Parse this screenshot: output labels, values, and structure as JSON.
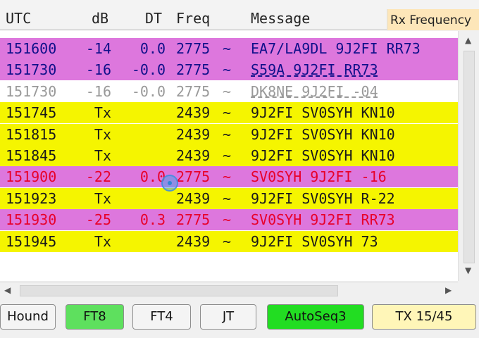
{
  "header": {
    "utc": "UTC",
    "db": "dB",
    "dt": "DT",
    "freq": "Freq",
    "message": "Message",
    "rx_frequency": "Rx Frequency"
  },
  "colors": {
    "header_bg": "#f3f3f3",
    "rx_tab_bg": "#fde6b9",
    "decode_for_me": "#dd77dd",
    "tx_row": "#f5f500",
    "normal_row": "#ffffff",
    "ft8_green": "#5ee05e",
    "autoseq_green": "#22dd22",
    "tx_period_bg": "#fff6b8"
  },
  "rows": [
    {
      "utc": "151600",
      "db": "-14",
      "dt": "0.0",
      "freq": "2775",
      "tilde": "~",
      "msg": "EA7/LA9DL 9J2FI RR73",
      "bg": "#dd77dd",
      "fg": "#10108a",
      "underlined": false
    },
    {
      "utc": "151730",
      "db": "-16",
      "dt": "-0.0",
      "freq": "2775",
      "tilde": "~",
      "msg": "S59A 9J2FI RR73",
      "bg": "#dd77dd",
      "fg": "#10108a",
      "underlined": true
    },
    {
      "utc": "151730",
      "db": "-16",
      "dt": "-0.0",
      "freq": "2775",
      "tilde": "~",
      "msg": "DK8NE 9J2FI -04",
      "bg": "#ffffff",
      "fg": "#999999",
      "underlined": true
    },
    {
      "utc": "151745",
      "db": "Tx",
      "dt": "",
      "freq": "2439",
      "tilde": "~",
      "msg": "9J2FI SV0SYH KN10",
      "bg": "#f5f500",
      "fg": "#1a1a1a",
      "underlined": false
    },
    {
      "utc": "151815",
      "db": "Tx",
      "dt": "",
      "freq": "2439",
      "tilde": "~",
      "msg": "9J2FI SV0SYH KN10",
      "bg": "#f5f500",
      "fg": "#1a1a1a",
      "underlined": false
    },
    {
      "utc": "151845",
      "db": "Tx",
      "dt": "",
      "freq": "2439",
      "tilde": "~",
      "msg": "9J2FI SV0SYH KN10",
      "bg": "#f5f500",
      "fg": "#1a1a1a",
      "underlined": false
    },
    {
      "utc": "151900",
      "db": "-22",
      "dt": "0.0",
      "freq": "2775",
      "tilde": "~",
      "msg": "SV0SYH 9J2FI -16",
      "bg": "#dd77dd",
      "fg": "#e8002a",
      "underlined": false
    },
    {
      "utc": "151923",
      "db": "Tx",
      "dt": "",
      "freq": "2439",
      "tilde": "~",
      "msg": "9J2FI SV0SYH R-22",
      "bg": "#f5f500",
      "fg": "#1a1a1a",
      "underlined": false
    },
    {
      "utc": "151930",
      "db": "-25",
      "dt": "0.3",
      "freq": "2775",
      "tilde": "~",
      "msg": "SV0SYH 9J2FI RR73",
      "bg": "#dd77dd",
      "fg": "#e8002a",
      "underlined": false
    },
    {
      "utc": "151945",
      "db": "Tx",
      "dt": "",
      "freq": "2439",
      "tilde": "~",
      "msg": "9J2FI SV0SYH 73",
      "bg": "#f5f500",
      "fg": "#1a1a1a",
      "underlined": false
    }
  ],
  "buttons": {
    "hound": {
      "label": "Hound"
    },
    "ft8": {
      "label": "FT8"
    },
    "ft4": {
      "label": "FT4"
    },
    "jt": {
      "label": "JT"
    },
    "autoseq": {
      "label": "AutoSeq3"
    },
    "tx_period": {
      "label": "TX 15/45"
    }
  },
  "icons": {
    "scroll_up": "▲",
    "scroll_down": "▼",
    "scroll_left": "◀",
    "scroll_right": "▶"
  }
}
